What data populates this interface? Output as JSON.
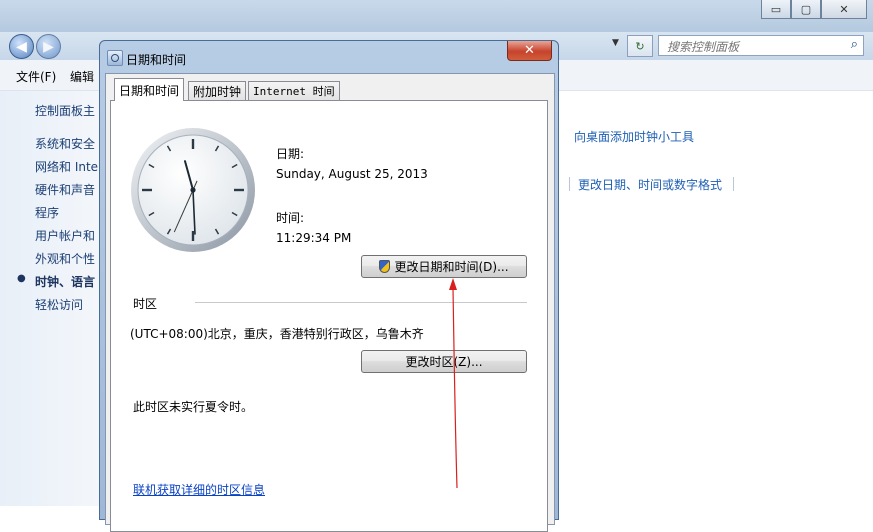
{
  "window": {
    "caption_minimize": "▭",
    "caption_maximize": "▢",
    "caption_close": "✕"
  },
  "nav": {
    "back": "◀",
    "forward": "▶",
    "address_dropdown": "▼",
    "refresh": "↻",
    "search_placeholder": "搜索控制面板"
  },
  "menubar": {
    "file": "文件(F)",
    "edit": "编辑"
  },
  "sidebar": {
    "items": [
      {
        "label": "控制面板主"
      },
      {
        "label": "系统和安全"
      },
      {
        "label": "网络和 Inte"
      },
      {
        "label": "硬件和声音"
      },
      {
        "label": "程序"
      },
      {
        "label": "用户帐户和"
      },
      {
        "label": "外观和个性"
      },
      {
        "label": "时钟、语言"
      },
      {
        "label": "轻松访问"
      }
    ],
    "active_bullet": "●"
  },
  "main": {
    "link_gadget": "向桌面添加时钟小工具",
    "link_format": "更改日期、时间或数字格式"
  },
  "dialog": {
    "title": "日期和时间",
    "close": "✕",
    "tabs": [
      {
        "label": "日期和时间",
        "active": true
      },
      {
        "label": "附加时钟",
        "active": false
      },
      {
        "label": "Internet 时间",
        "active": false
      }
    ],
    "date_label": "日期:",
    "date_value": "Sunday, August 25, 2013",
    "time_label": "时间:",
    "time_value": "11:29:34 PM",
    "change_datetime_button": "更改日期和时间(D)...",
    "timezone_group": "时区",
    "timezone_value": "(UTC+08:00)北京，重庆，香港特别行政区，乌鲁木齐",
    "change_timezone_button": "更改时区(Z)...",
    "dst_note": "此时区未实行夏令时。",
    "link_timezone_info": "联机获取详细的时区信息",
    "clock": {
      "hours": 11,
      "minutes": 29,
      "seconds": 34
    }
  },
  "colors": {
    "link": "#0a42c4",
    "annotation_arrow": "#d9201e",
    "close_button": "#c7432c"
  }
}
